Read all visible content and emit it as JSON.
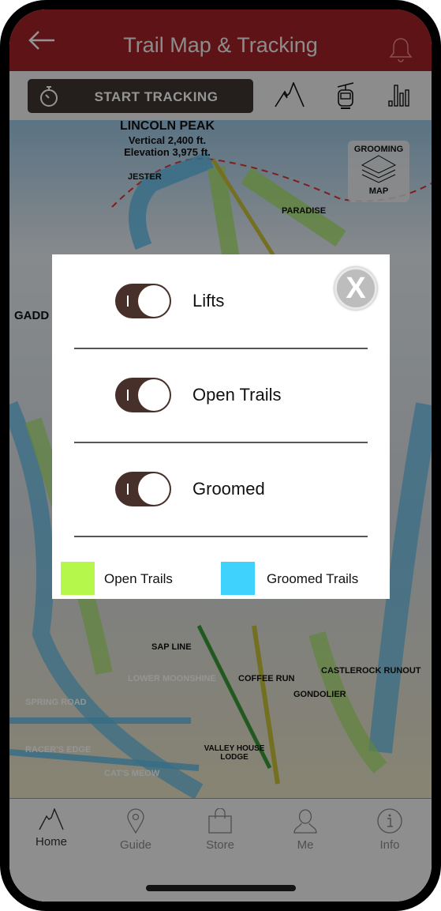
{
  "header": {
    "title": "Trail Map & Tracking",
    "back_icon": "arrow-left-icon",
    "bell_icon": "bell-icon"
  },
  "toolbar": {
    "start_tracking_label": "START TRACKING",
    "icons": [
      "stopwatch-icon",
      "mountain-icon",
      "gondola-icon",
      "bar-chart-icon"
    ]
  },
  "map": {
    "peak_name": "LINCOLN PEAK",
    "peak_vertical": "Vertical 2,400 ft.",
    "peak_elevation": "Elevation 3,975 ft.",
    "grooming_button": {
      "top": "GROOMING",
      "bottom": "MAP"
    },
    "labels": [
      "JESTER",
      "PARADISE",
      "SPRING ROAD",
      "RACER'S EDGE",
      "LOWER MOONSHINE",
      "SAP LINE",
      "COFFEE RUN",
      "GONDOLIER",
      "CASTLEROCK RUNOUT",
      "CAT'S MEOW",
      "VALLEY HOUSE LODGE",
      "GADD"
    ]
  },
  "modal": {
    "close_label": "X",
    "toggles": [
      {
        "label": "Lifts",
        "on": true
      },
      {
        "label": "Open Trails",
        "on": true
      },
      {
        "label": "Groomed",
        "on": true
      }
    ],
    "legend": [
      {
        "label": "Open Trails",
        "color": "#b5f74a"
      },
      {
        "label": "Groomed Trails",
        "color": "#3fd2fc"
      }
    ]
  },
  "tabbar": {
    "tabs": [
      {
        "label": "Home",
        "icon": "mountain-icon",
        "active": true
      },
      {
        "label": "Guide",
        "icon": "map-pin-icon",
        "active": false
      },
      {
        "label": "Store",
        "icon": "shopping-bag-icon",
        "active": false
      },
      {
        "label": "Me",
        "icon": "person-icon",
        "active": false
      },
      {
        "label": "Info",
        "icon": "info-icon",
        "active": false
      }
    ]
  },
  "colors": {
    "header": "#a32226",
    "toggle": "#48302a",
    "track_button": "#3e3533"
  }
}
